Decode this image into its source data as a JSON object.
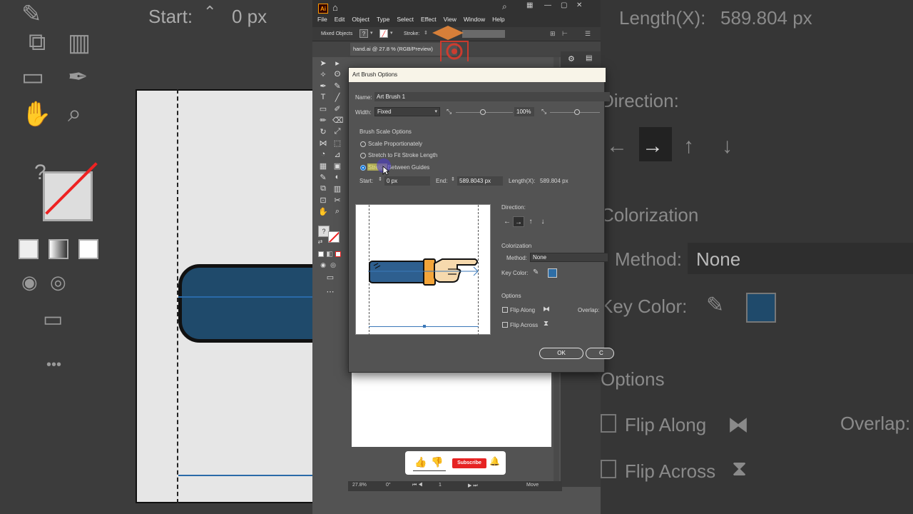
{
  "app": {
    "logo": "Ai",
    "menus": [
      "File",
      "Edit",
      "Object",
      "Type",
      "Select",
      "Effect",
      "View",
      "Window",
      "Help"
    ],
    "window_controls": [
      "—",
      "▢",
      "✕"
    ],
    "control_bar": {
      "selection": "Mixed Objects",
      "stroke_label": "Stroke:"
    },
    "document_tab": "hand.ai @ 27.8 % (RGB/Preview)",
    "status": {
      "zoom": "27.8%",
      "rotation": "0°",
      "artboard": "1",
      "tool": "Move"
    }
  },
  "dialog": {
    "title": "Art Brush Options",
    "name_label": "Name:",
    "name_value": "Art Brush 1",
    "width_label": "Width:",
    "width_value": "Fixed",
    "width_percent": "100%",
    "scale_section": "Brush Scale Options",
    "scale_options": [
      "Scale Proportionately",
      "Stretch to Fit Stroke Length",
      "Stretch Between Guides"
    ],
    "selected_scale_option": 2,
    "start_label": "Start:",
    "start_value": "0 px",
    "end_label": "End:",
    "end_value": "589.8043 px",
    "length_label": "Length(X):",
    "length_value": "589.804 px",
    "direction_label": "Direction:",
    "direction_buttons": [
      "←",
      "→",
      "↑",
      "↓"
    ],
    "selected_direction": 1,
    "colorization_section": "Colorization",
    "method_label": "Method:",
    "method_value": "None",
    "key_color_label": "Key Color:",
    "key_color": "#2e6ea6",
    "options_section": "Options",
    "flip_along_label": "Flip Along",
    "flip_across_label": "Flip Across",
    "overlap_label": "Overlap:",
    "ok_label": "OK",
    "cancel_label": "C"
  },
  "background_zoom": {
    "start_label": "Start:",
    "start_value": "0 px",
    "length_label": "Length(X):",
    "length_value": "589.804 px",
    "direction_label": "Direction:",
    "colorization_label": "Colorization",
    "method_label": "Method:",
    "method_value": "None",
    "key_color_label": "Key Color:",
    "options_label": "Options",
    "flip_along_label": "Flip Along",
    "flip_across_label": "Flip Across",
    "overlap_label": "Overlap:",
    "question_mark": "?"
  },
  "subscribe_widget": {
    "subscribe_label": "Subscribe"
  },
  "colors": {
    "accent_blue": "#1b79d6",
    "subscribe_red": "#e62323",
    "arm_blue": "#2e5f8f"
  }
}
